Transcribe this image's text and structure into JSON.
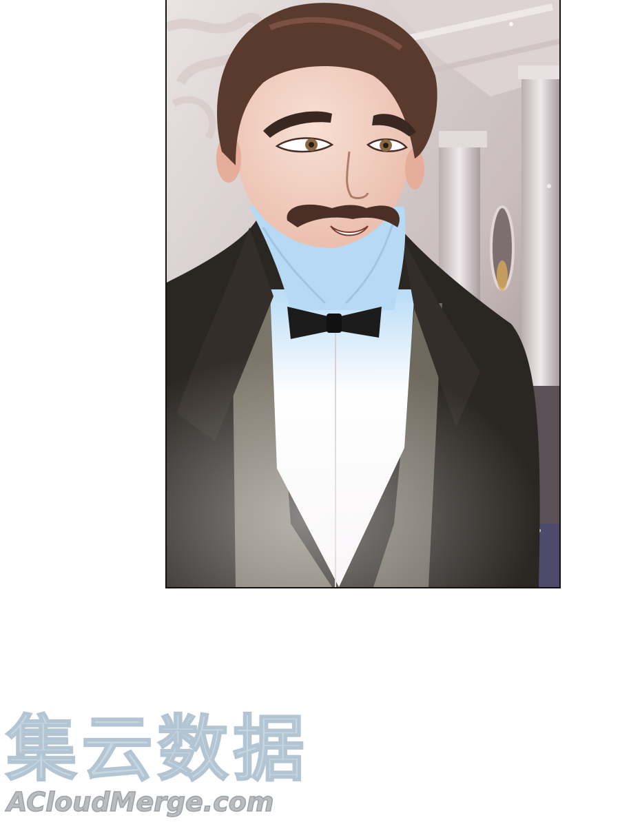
{
  "comic": {
    "panel": {
      "subject": "gentleman-portrait"
    }
  },
  "watermark": {
    "chinese_text": "集云数据",
    "site_text": "ACloudMerge.com"
  },
  "colors": {
    "page_background": "#ffffff",
    "panel_border": "#111111",
    "hair": "#5a3a2c",
    "skin": "#f3d4c6",
    "jacket": "#2a2622",
    "vest": "#7b7468",
    "shirt": "#ffffff",
    "collar": "#b7daf4",
    "bowtie": "#1b1b1b",
    "watermark_text": "#c7d7e2"
  }
}
